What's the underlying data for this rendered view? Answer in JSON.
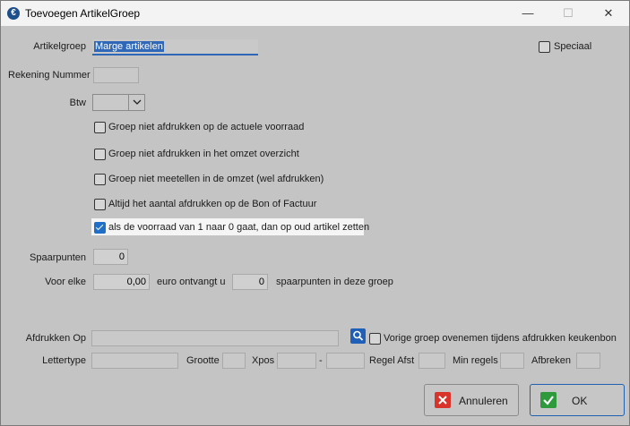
{
  "window": {
    "title": "Toevoegen ArtikelGroep"
  },
  "titlebar_buttons": {
    "minimize": "—",
    "maximize": "☐",
    "close": "✕"
  },
  "form": {
    "artikelgroep_label": "Artikelgroep",
    "artikelgroep_value": "Marge artikelen",
    "speciaal_label": "Speciaal",
    "speciaal_checked": false,
    "rekening_label": "Rekening Nummer",
    "rekening_value": "",
    "btw_label": "Btw",
    "btw_value": "",
    "options": [
      {
        "label": "Groep niet afdrukken op de actuele voorraad",
        "checked": false
      },
      {
        "label": "Groep niet afdrukken in het omzet overzicht",
        "checked": false
      },
      {
        "label": "Groep niet meetellen in de omzet (wel afdrukken)",
        "checked": false
      },
      {
        "label": "Altijd het aantal afdrukken op de Bon of Factuur",
        "checked": false
      },
      {
        "label": "als de voorraad van 1 naar 0 gaat, dan op oud artikel zetten",
        "checked": true
      }
    ],
    "spaarpunten_label": "Spaarpunten",
    "spaarpunten_value": "0",
    "voor_elke_label": "Voor elke",
    "voor_elke_value": "0,00",
    "euro_label": "euro ontvangt u",
    "punten_value": "0",
    "punten_label": "spaarpunten in deze groep",
    "afdrukken_op_label": "Afdrukken Op",
    "afdrukken_op_value": "",
    "vorige_groep_label": "Vorige groep ovenemen tijdens afdrukken keukenbon",
    "vorige_groep_checked": false,
    "lettertype_label": "Lettertype",
    "grootte_label": "Grootte",
    "xpos_label": "Xpos",
    "dash_label": "-",
    "regel_afst_label": "Regel Afst",
    "min_regels_label": "Min regels",
    "afbreken_label": "Afbreken"
  },
  "buttons": {
    "cancel_label": "Annuleren",
    "ok_label": "OK"
  },
  "icons": {
    "cancel": "red-x-icon",
    "ok": "green-check-icon",
    "search": "magnifier-icon",
    "dropdown": "chevron-down-icon"
  },
  "colors": {
    "accent": "#2f68b8",
    "cancel_red": "#d9342b",
    "ok_green": "#2e9a3c"
  }
}
